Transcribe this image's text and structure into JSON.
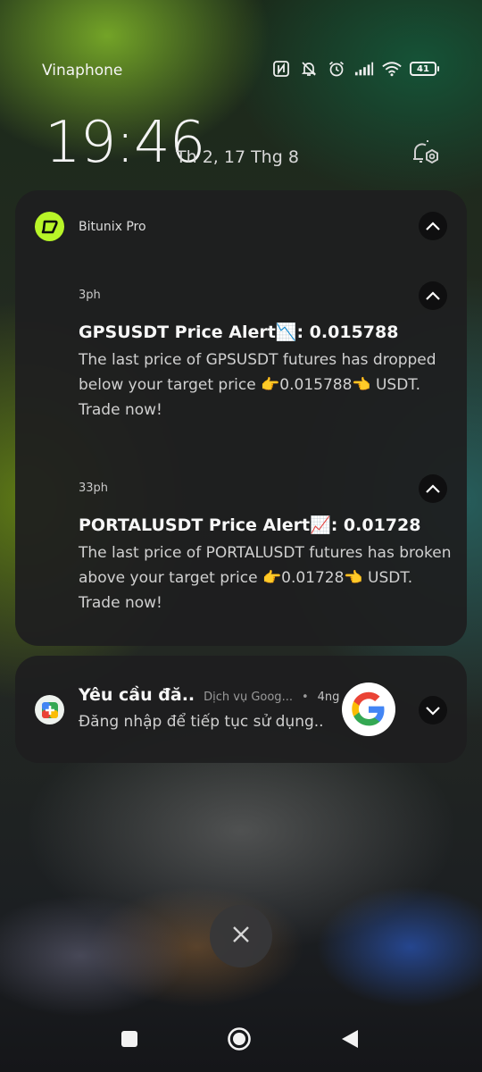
{
  "status_bar": {
    "carrier": "Vinaphone",
    "battery_level": "41",
    "icons": [
      "nfc-icon",
      "bell-off-icon",
      "alarm-icon",
      "signal-icon",
      "wifi-icon",
      "battery-icon"
    ]
  },
  "lockscreen": {
    "time": "19:46",
    "date": "Th 2, 17 Thg 8"
  },
  "notifications": {
    "bitunix": {
      "app_name": "Bitunix Pro",
      "accent": "#b8f528",
      "items": [
        {
          "time": "3ph",
          "title": "GPSUSDT Price Alert📉: 0.015788",
          "body": "The last price of GPSUSDT futures has dropped below your target price 👉0.015788👈 USDT. Trade now!"
        },
        {
          "time": "33ph",
          "title": "PORTALUSDT Price Alert📈: 0.01728",
          "body": "The last price of PORTALUSDT futures has broken above your target price 👉0.01728👈 USDT. Trade now!"
        }
      ]
    },
    "google": {
      "title": "Yêu cầu đă..",
      "source": "Dịch vụ Goog...",
      "separator": "•",
      "time": "4ng",
      "body": "Đăng nhập để tiếp tục sử dụng.."
    }
  },
  "controls": {
    "clear_all_icon": "close-icon"
  },
  "nav_bar": {
    "buttons": [
      "recents-button",
      "home-button",
      "back-button"
    ]
  }
}
